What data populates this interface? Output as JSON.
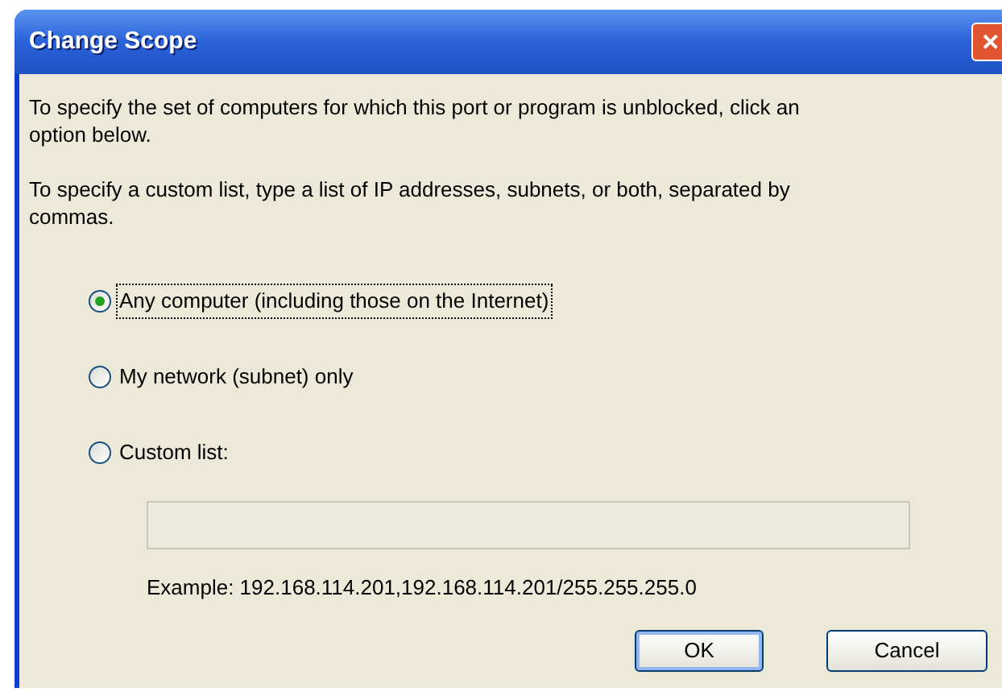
{
  "window": {
    "title": "Change Scope",
    "close": "✕"
  },
  "instructions": [
    "To specify the set of computers for which this port or program is unblocked, click an option below.",
    "To specify a custom list, type a list of IP addresses, subnets, or both, separated by commas."
  ],
  "options": [
    {
      "label": "Any computer (including those on the Internet)",
      "selected": true
    },
    {
      "label": "My network (subnet) only",
      "selected": false
    },
    {
      "label": "Custom list:",
      "selected": false
    }
  ],
  "custom_list": {
    "disabled": true
  },
  "example": "Example: 192.168.114.201,192.168.114.201/255.255.255.0",
  "buttons": [
    {
      "label": "OK",
      "default": true
    },
    {
      "label": "Cancel",
      "default": false
    }
  ]
}
